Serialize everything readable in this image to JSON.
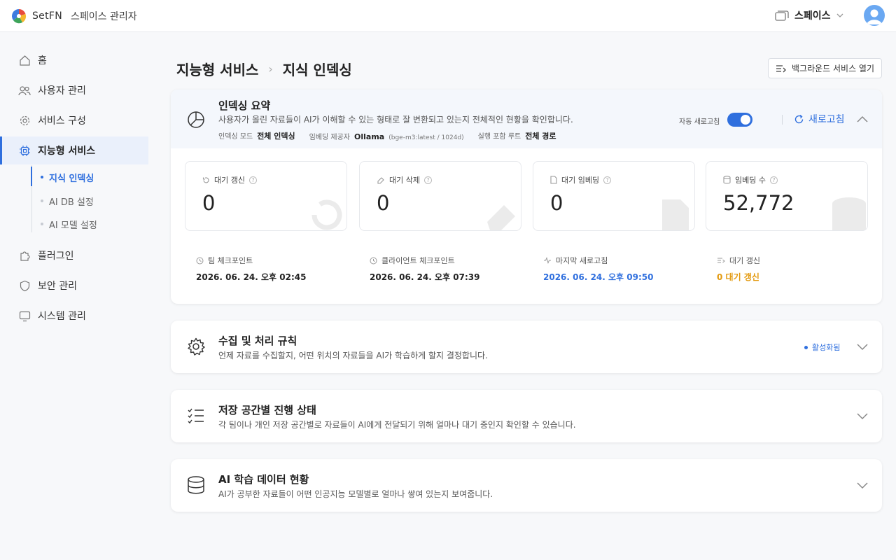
{
  "app": {
    "brand": "SetFN",
    "subtitle": "스페이스 관리자"
  },
  "header": {
    "space_label": "스페이스"
  },
  "sidebar": {
    "items": [
      {
        "label": "홈",
        "icon": "home-icon"
      },
      {
        "label": "사용자 관리",
        "icon": "users-icon"
      },
      {
        "label": "서비스 구성",
        "icon": "gear-icon"
      },
      {
        "label": "지능형 서비스",
        "icon": "chip-icon"
      },
      {
        "label": "플러그인",
        "icon": "puzzle-icon"
      },
      {
        "label": "보안 관리",
        "icon": "shield-icon"
      },
      {
        "label": "시스템 관리",
        "icon": "monitor-icon"
      }
    ],
    "sub_items": [
      {
        "label": "지식 인덱싱"
      },
      {
        "label": "AI DB 설정"
      },
      {
        "label": "AI 모델 설정"
      }
    ]
  },
  "breadcrumb": {
    "parent": "지능형 서비스",
    "current": "지식 인덱싱"
  },
  "bg_button": "백그라운드 서비스 열기",
  "summary": {
    "title": "인덱싱 요약",
    "desc": "사용자가 올린 자료들이 AI가 이해할 수 있는 형태로 잘 변환되고 있는지 전체적인 현황을 확인합니다.",
    "meta": [
      {
        "label": "인덱싱 모드",
        "value": "전체 인덱싱",
        "extra": ""
      },
      {
        "label": "임베딩 제공자",
        "value": "Ollama",
        "extra": "(bge-m3:latest / 1024d)"
      },
      {
        "label": "실행 포함 루트",
        "value": "전체 경로",
        "extra": ""
      }
    ],
    "auto_refresh_label": "자동 새로고침",
    "auto_refresh_on": true,
    "refresh_label": "새로고침",
    "stats": [
      {
        "label": "대기 갱신",
        "value": "0"
      },
      {
        "label": "대기 삭제",
        "value": "0"
      },
      {
        "label": "대기 임베딩",
        "value": "0"
      },
      {
        "label": "임베딩 수",
        "value": "52,772"
      }
    ],
    "checkpoints": [
      {
        "label": "팀 체크포인트",
        "value": "2026. 06. 24. 오후 02:45"
      },
      {
        "label": "클라이언트 체크포인트",
        "value": "2026. 06. 24. 오후 07:39"
      },
      {
        "label": "마지막 새로고침",
        "value": "2026. 06. 24. 오후 09:50"
      },
      {
        "label": "대기 갱신",
        "value": "0 대기 갱신"
      }
    ]
  },
  "sections": [
    {
      "title": "수집 및 처리 규칙",
      "desc": "언제 자료를 수집할지, 어떤 위치의 자료들을 AI가 학습하게 할지 결정합니다.",
      "status": "활성화됨"
    },
    {
      "title": "저장 공간별 진행 상태",
      "desc": "각 팀이나 개인 저장 공간별로 자료들이 AI에게 전달되기 위해 얼마나 대기 중인지 확인할 수 있습니다."
    },
    {
      "title": "AI 학습 데이터 현황",
      "desc": "AI가 공부한 자료들이 어떤 인공지능 모델별로 얼마나 쌓여 있는지 보여줍니다."
    }
  ],
  "colors": {
    "accent": "#2f6fde",
    "warning": "#e39a10"
  }
}
